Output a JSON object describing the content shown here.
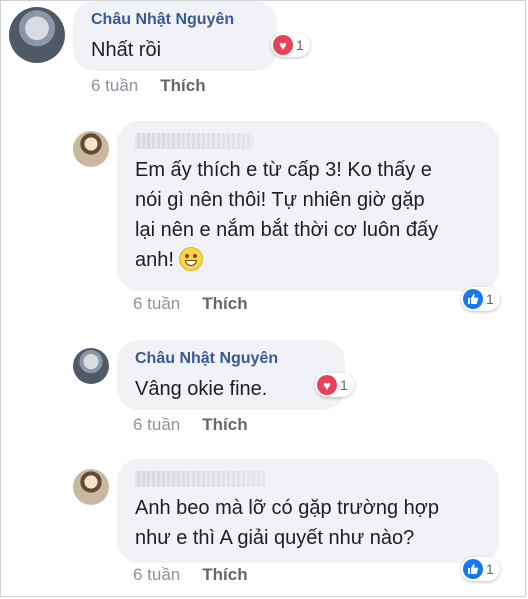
{
  "comments": [
    {
      "author": "Châu Nhật Nguyên",
      "text": "Nhất rồi",
      "time": "6 tuần",
      "like_label": "Thích",
      "reaction": {
        "type": "heart",
        "count": "1"
      }
    },
    {
      "author": "",
      "text": "Em ấy thích e từ cấp 3! Ko thấy e\nnói gì nên thôi! Tự nhiên giờ gặp\nlại nên e nắm bắt thời cơ luôn đấy\nanh! ",
      "time": "6 tuần",
      "like_label": "Thích",
      "reaction": {
        "type": "like",
        "count": "1"
      }
    },
    {
      "author": "Châu Nhật Nguyên",
      "text": "Vâng okie fine.",
      "time": "6 tuần",
      "like_label": "Thích",
      "reaction": {
        "type": "heart",
        "count": "1"
      }
    },
    {
      "author": "",
      "text": "Anh beo mà lỡ có gặp trường hợp\nnhư e thì A giải quyết như nào?",
      "time": "6 tuần",
      "like_label": "Thích",
      "reaction": {
        "type": "like",
        "count": "1"
      }
    }
  ],
  "icons": {
    "heart": "heart-icon",
    "like": "thumbs-up-icon",
    "emoji": "grinning-emoji"
  },
  "colors": {
    "name": "#385898",
    "bubble": "#f0f2f5",
    "heart": "#e9405a",
    "like": "#1877f2",
    "meta": "#8d949e"
  }
}
